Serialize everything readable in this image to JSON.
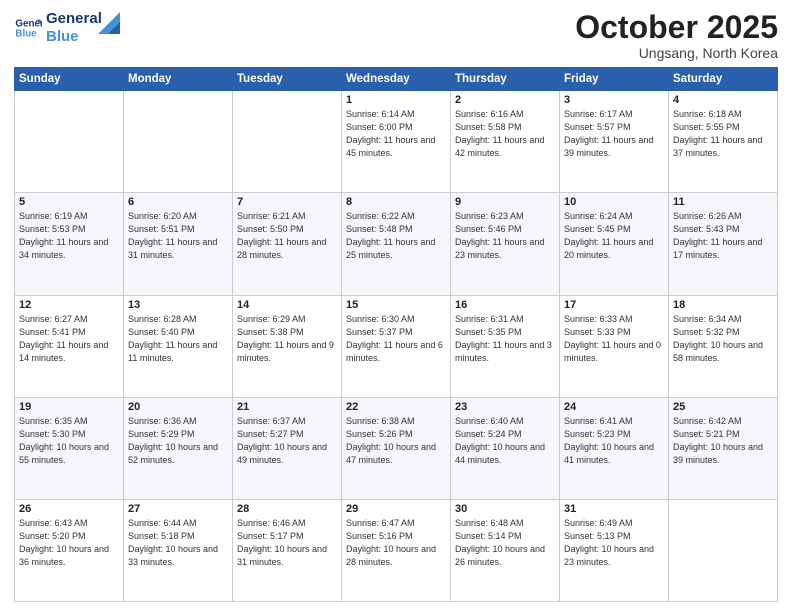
{
  "logo": {
    "line1": "General",
    "line2": "Blue"
  },
  "header": {
    "month": "October 2025",
    "location": "Ungsang, North Korea"
  },
  "weekdays": [
    "Sunday",
    "Monday",
    "Tuesday",
    "Wednesday",
    "Thursday",
    "Friday",
    "Saturday"
  ],
  "weeks": [
    [
      {
        "day": "",
        "info": ""
      },
      {
        "day": "",
        "info": ""
      },
      {
        "day": "",
        "info": ""
      },
      {
        "day": "1",
        "info": "Sunrise: 6:14 AM\nSunset: 6:00 PM\nDaylight: 11 hours\nand 45 minutes."
      },
      {
        "day": "2",
        "info": "Sunrise: 6:16 AM\nSunset: 5:58 PM\nDaylight: 11 hours\nand 42 minutes."
      },
      {
        "day": "3",
        "info": "Sunrise: 6:17 AM\nSunset: 5:57 PM\nDaylight: 11 hours\nand 39 minutes."
      },
      {
        "day": "4",
        "info": "Sunrise: 6:18 AM\nSunset: 5:55 PM\nDaylight: 11 hours\nand 37 minutes."
      }
    ],
    [
      {
        "day": "5",
        "info": "Sunrise: 6:19 AM\nSunset: 5:53 PM\nDaylight: 11 hours\nand 34 minutes."
      },
      {
        "day": "6",
        "info": "Sunrise: 6:20 AM\nSunset: 5:51 PM\nDaylight: 11 hours\nand 31 minutes."
      },
      {
        "day": "7",
        "info": "Sunrise: 6:21 AM\nSunset: 5:50 PM\nDaylight: 11 hours\nand 28 minutes."
      },
      {
        "day": "8",
        "info": "Sunrise: 6:22 AM\nSunset: 5:48 PM\nDaylight: 11 hours\nand 25 minutes."
      },
      {
        "day": "9",
        "info": "Sunrise: 6:23 AM\nSunset: 5:46 PM\nDaylight: 11 hours\nand 23 minutes."
      },
      {
        "day": "10",
        "info": "Sunrise: 6:24 AM\nSunset: 5:45 PM\nDaylight: 11 hours\nand 20 minutes."
      },
      {
        "day": "11",
        "info": "Sunrise: 6:26 AM\nSunset: 5:43 PM\nDaylight: 11 hours\nand 17 minutes."
      }
    ],
    [
      {
        "day": "12",
        "info": "Sunrise: 6:27 AM\nSunset: 5:41 PM\nDaylight: 11 hours\nand 14 minutes."
      },
      {
        "day": "13",
        "info": "Sunrise: 6:28 AM\nSunset: 5:40 PM\nDaylight: 11 hours\nand 11 minutes."
      },
      {
        "day": "14",
        "info": "Sunrise: 6:29 AM\nSunset: 5:38 PM\nDaylight: 11 hours\nand 9 minutes."
      },
      {
        "day": "15",
        "info": "Sunrise: 6:30 AM\nSunset: 5:37 PM\nDaylight: 11 hours\nand 6 minutes."
      },
      {
        "day": "16",
        "info": "Sunrise: 6:31 AM\nSunset: 5:35 PM\nDaylight: 11 hours\nand 3 minutes."
      },
      {
        "day": "17",
        "info": "Sunrise: 6:33 AM\nSunset: 5:33 PM\nDaylight: 11 hours\nand 0 minutes."
      },
      {
        "day": "18",
        "info": "Sunrise: 6:34 AM\nSunset: 5:32 PM\nDaylight: 10 hours\nand 58 minutes."
      }
    ],
    [
      {
        "day": "19",
        "info": "Sunrise: 6:35 AM\nSunset: 5:30 PM\nDaylight: 10 hours\nand 55 minutes."
      },
      {
        "day": "20",
        "info": "Sunrise: 6:36 AM\nSunset: 5:29 PM\nDaylight: 10 hours\nand 52 minutes."
      },
      {
        "day": "21",
        "info": "Sunrise: 6:37 AM\nSunset: 5:27 PM\nDaylight: 10 hours\nand 49 minutes."
      },
      {
        "day": "22",
        "info": "Sunrise: 6:38 AM\nSunset: 5:26 PM\nDaylight: 10 hours\nand 47 minutes."
      },
      {
        "day": "23",
        "info": "Sunrise: 6:40 AM\nSunset: 5:24 PM\nDaylight: 10 hours\nand 44 minutes."
      },
      {
        "day": "24",
        "info": "Sunrise: 6:41 AM\nSunset: 5:23 PM\nDaylight: 10 hours\nand 41 minutes."
      },
      {
        "day": "25",
        "info": "Sunrise: 6:42 AM\nSunset: 5:21 PM\nDaylight: 10 hours\nand 39 minutes."
      }
    ],
    [
      {
        "day": "26",
        "info": "Sunrise: 6:43 AM\nSunset: 5:20 PM\nDaylight: 10 hours\nand 36 minutes."
      },
      {
        "day": "27",
        "info": "Sunrise: 6:44 AM\nSunset: 5:18 PM\nDaylight: 10 hours\nand 33 minutes."
      },
      {
        "day": "28",
        "info": "Sunrise: 6:46 AM\nSunset: 5:17 PM\nDaylight: 10 hours\nand 31 minutes."
      },
      {
        "day": "29",
        "info": "Sunrise: 6:47 AM\nSunset: 5:16 PM\nDaylight: 10 hours\nand 28 minutes."
      },
      {
        "day": "30",
        "info": "Sunrise: 6:48 AM\nSunset: 5:14 PM\nDaylight: 10 hours\nand 26 minutes."
      },
      {
        "day": "31",
        "info": "Sunrise: 6:49 AM\nSunset: 5:13 PM\nDaylight: 10 hours\nand 23 minutes."
      },
      {
        "day": "",
        "info": ""
      }
    ]
  ]
}
